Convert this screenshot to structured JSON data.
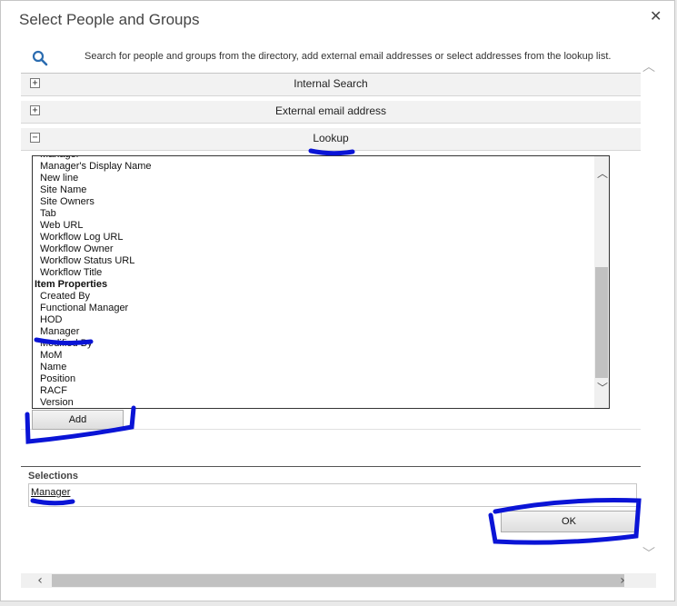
{
  "dialog": {
    "title": "Select People and Groups",
    "close_glyph": "✕"
  },
  "search": {
    "hint": "Search for people and groups from the directory, add external email addresses or select addresses from the lookup list."
  },
  "sections": [
    {
      "toggle": "+",
      "label": "Internal Search"
    },
    {
      "toggle": "+",
      "label": "External email address"
    },
    {
      "toggle": "−",
      "label": "Lookup"
    }
  ],
  "lookup_list": {
    "items": [
      "Manager",
      "Manager's Display Name",
      "New line",
      "Site Name",
      "Site Owners",
      "Tab",
      "Web URL",
      "Workflow Log URL",
      "Workflow Owner",
      "Workflow Status URL",
      "Workflow Title",
      "Item Properties",
      "Created By",
      "Functional Manager",
      "HOD",
      "Manager",
      "Modified By",
      "MoM",
      "Name",
      "Position",
      "RACF",
      "Version"
    ],
    "group_headers": [
      "Item Properties"
    ]
  },
  "buttons": {
    "add": "Add",
    "ok": "OK"
  },
  "selections": {
    "label": "Selections",
    "items": [
      "Manager"
    ]
  },
  "icons": [
    "search-icon",
    "close-icon",
    "expand-icon",
    "collapse-icon",
    "chevron-up-icon",
    "chevron-down-icon",
    "chevron-left-icon",
    "chevron-right-icon"
  ],
  "colors": {
    "annotation_ink": "#0a14d6",
    "search_icon": "#2b6cb0"
  }
}
